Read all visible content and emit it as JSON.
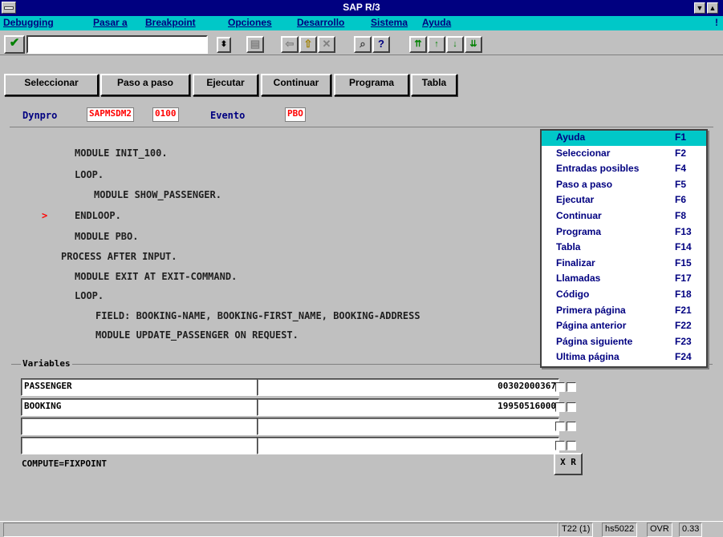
{
  "window": {
    "title": "SAP R/3"
  },
  "menubar": {
    "items": [
      "Debugging",
      "Pasar a",
      "Breakpoint",
      "Opciones",
      "Desarrollo",
      "Sistema",
      "Ayuda"
    ],
    "trailing": "!"
  },
  "toolbar": {
    "command_value": ""
  },
  "buttons": [
    "Seleccionar",
    "Paso a paso",
    "Ejecutar",
    "Continuar",
    "Programa",
    "Tabla"
  ],
  "info": {
    "dynpro_label": "Dynpro",
    "dynpro_program": "SAPMSDM2",
    "dynpro_number": "0100",
    "evento_label": "Evento",
    "evento_value": "PBO"
  },
  "code": {
    "lines": [
      "MODULE INIT_100.",
      "LOOP.",
      "MODULE SHOW_PASSENGER.",
      "ENDLOOP.",
      "MODULE PBO.",
      "PROCESS AFTER INPUT.",
      "MODULE EXIT AT EXIT-COMMAND.",
      "LOOP.",
      "FIELD: BOOKING-NAME, BOOKING-FIRST_NAME, BOOKING-ADDRESS",
      "MODULE UPDATE_PASSENGER ON REQUEST."
    ],
    "current_marker": ">"
  },
  "variables": {
    "label": "Variables",
    "rows": [
      {
        "name": "PASSENGER",
        "value": "00302000367"
      },
      {
        "name": "BOOKING",
        "value": "19950516000"
      },
      {
        "name": "",
        "value": ""
      },
      {
        "name": "",
        "value": ""
      }
    ],
    "status": "COMPUTE=FIXPOINT",
    "xr_button": "X R"
  },
  "popup_menu": {
    "items": [
      {
        "label": "Ayuda",
        "key": "F1",
        "selected": true
      },
      {
        "label": "Seleccionar",
        "key": "F2"
      },
      {
        "label": "Entradas posibles",
        "key": "F4"
      },
      {
        "label": "Paso a paso",
        "key": "F5"
      },
      {
        "label": "Ejecutar",
        "key": "F6"
      },
      {
        "label": "Continuar",
        "key": "F8"
      },
      {
        "label": "Programa",
        "key": "F13"
      },
      {
        "label": "Tabla",
        "key": "F14"
      },
      {
        "label": "Finalizar",
        "key": "F15"
      },
      {
        "label": "Llamadas",
        "key": "F17"
      },
      {
        "label": "Código",
        "key": "F18"
      },
      {
        "label": "Primera página",
        "key": "F21"
      },
      {
        "label": "Página anterior",
        "key": "F22"
      },
      {
        "label": "Página siguiente",
        "key": "F23"
      },
      {
        "label": "Ultima página",
        "key": "F24"
      }
    ]
  },
  "statusbar": {
    "session": "T22 (1)",
    "host": "hs5022",
    "mode": "OVR",
    "time": "0.33"
  },
  "colors": {
    "titlebar": "#000080",
    "menubar": "#00c8c8",
    "highlight": "#ff0000"
  }
}
